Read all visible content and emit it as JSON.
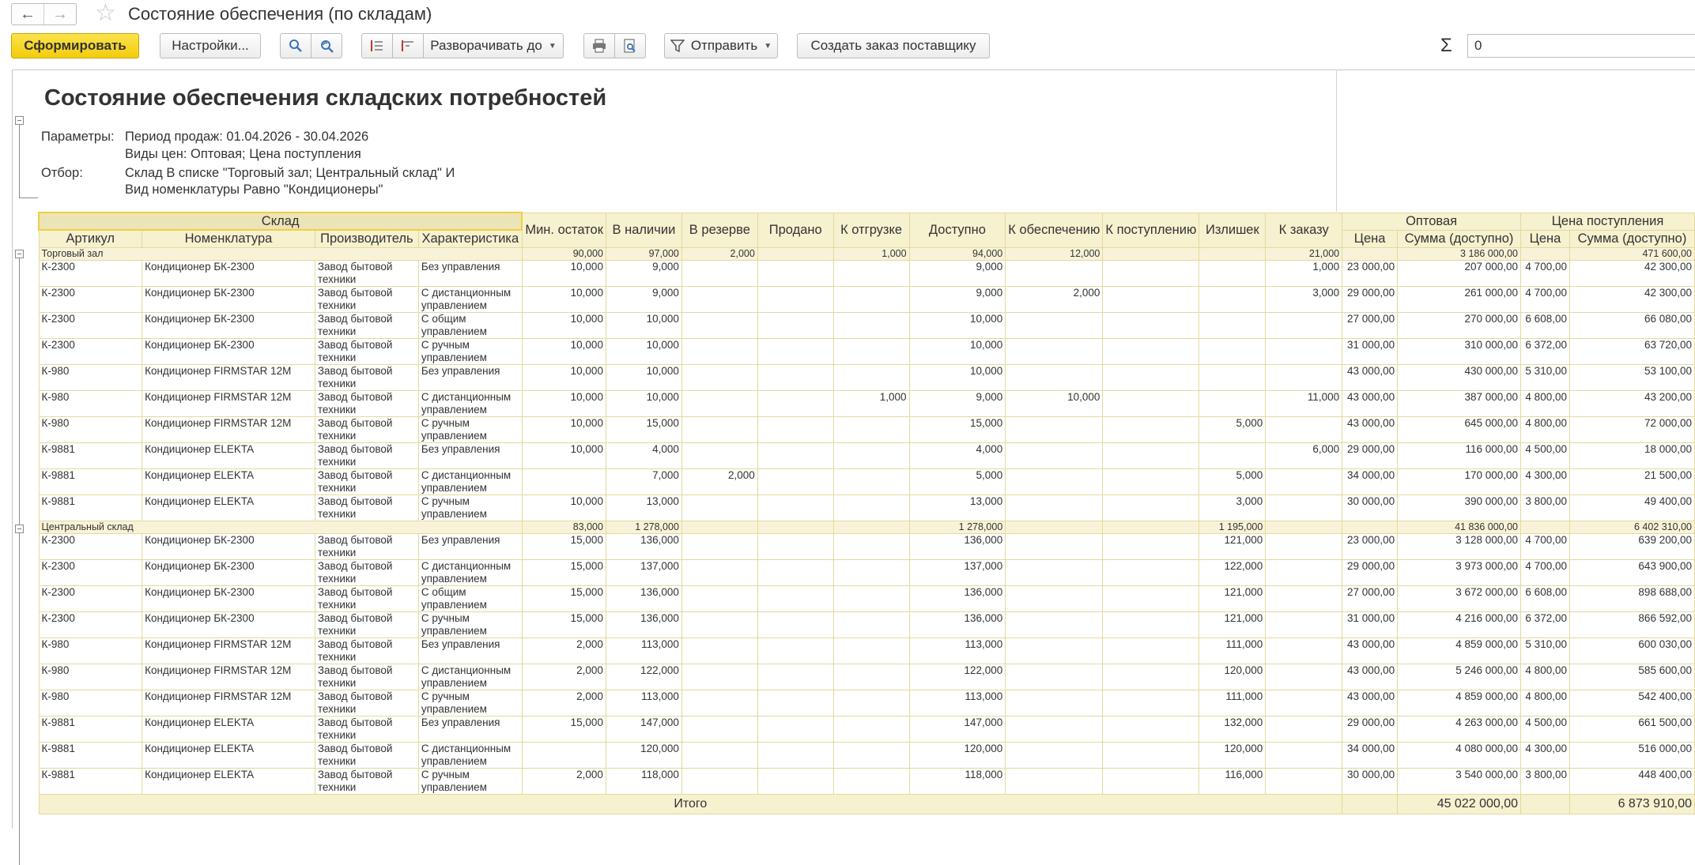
{
  "window": {
    "title": "Состояние обеспечения (по складам)",
    "nav_back": "←",
    "nav_forward": "→",
    "favorite": "☆"
  },
  "toolbar": {
    "generate_label": "Сформировать",
    "settings_label": "Настройки...",
    "expand_label": "Разворачивать до",
    "send_label": "Отправить",
    "create_order_label": "Создать заказ поставщику",
    "sigma": "Σ",
    "sum_value": "0"
  },
  "icons": {
    "search": "search-icon",
    "search_next": "search-next-icon",
    "collapse_groups": "collapse-groups-icon",
    "expand_groups": "expand-groups-icon",
    "print": "print-icon",
    "preview": "print-preview-icon",
    "send": "filter-send-icon"
  },
  "report": {
    "title": "Состояние обеспечения складских потребностей",
    "params_label": "Параметры:",
    "params_line1": "Период продаж: 01.04.2026 - 30.04.2026",
    "params_line2": "Виды цен: Оптовая; Цена поступления",
    "filter_label": "Отбор:",
    "filter_line1": "Склад В списке \"Торговый зал; Центральный склад\" И",
    "filter_line2": "Вид номенклатуры Равно \"Кондиционеры\""
  },
  "table": {
    "header_group": "Склад",
    "col_article": "Артикул",
    "col_nomenclature": "Номенклатура",
    "col_manufacturer": "Производитель",
    "col_characteristic": "Характеристика",
    "col_min_stock": "Мин. остаток",
    "col_in_stock": "В наличии",
    "col_reserved": "В резерве",
    "col_sold": "Продано",
    "col_to_ship": "К отгрузке",
    "col_available": "Доступно",
    "col_to_provide": "К обеспечению",
    "col_incoming": "К поступлению",
    "col_excess": "Излишек",
    "col_to_order": "К заказу",
    "price_group_wholesale": "Оптовая",
    "price_group_purchase": "Цена поступления",
    "col_price": "Цена",
    "col_sum_available": "Сумма (доступно)",
    "groups": [
      {
        "name": "Торговый зал",
        "totals": [
          "90,000",
          "97,000",
          "2,000",
          "",
          "1,000",
          "94,000",
          "12,000",
          "",
          "",
          "21,000",
          "",
          "3 186 000,00",
          "",
          "471 600,00"
        ],
        "rows": [
          [
            "К-2300",
            "Кондиционер БК-2300",
            "Завод бытовой техники",
            "Без управления",
            "10,000",
            "9,000",
            "",
            "",
            "",
            "9,000",
            "",
            "",
            "",
            "1,000",
            "23 000,00",
            "207 000,00",
            "4 700,00",
            "42 300,00"
          ],
          [
            "К-2300",
            "Кондиционер БК-2300",
            "Завод бытовой техники",
            "С дистанционным управлением",
            "10,000",
            "9,000",
            "",
            "",
            "",
            "9,000",
            "2,000",
            "",
            "",
            "3,000",
            "29 000,00",
            "261 000,00",
            "4 700,00",
            "42 300,00"
          ],
          [
            "К-2300",
            "Кондиционер БК-2300",
            "Завод бытовой техники",
            "С общим управлением",
            "10,000",
            "10,000",
            "",
            "",
            "",
            "10,000",
            "",
            "",
            "",
            "",
            "27 000,00",
            "270 000,00",
            "6 608,00",
            "66 080,00"
          ],
          [
            "К-2300",
            "Кондиционер БК-2300",
            "Завод бытовой техники",
            "С ручным управлением",
            "10,000",
            "10,000",
            "",
            "",
            "",
            "10,000",
            "",
            "",
            "",
            "",
            "31 000,00",
            "310 000,00",
            "6 372,00",
            "63 720,00"
          ],
          [
            "К-980",
            "Кондиционер FIRMSTAR 12M",
            "Завод бытовой техники",
            "Без управления",
            "10,000",
            "10,000",
            "",
            "",
            "",
            "10,000",
            "",
            "",
            "",
            "",
            "43 000,00",
            "430 000,00",
            "5 310,00",
            "53 100,00"
          ],
          [
            "К-980",
            "Кондиционер FIRMSTAR 12M",
            "Завод бытовой техники",
            "С дистанционным управлением",
            "10,000",
            "10,000",
            "",
            "",
            "1,000",
            "9,000",
            "10,000",
            "",
            "",
            "11,000",
            "43 000,00",
            "387 000,00",
            "4 800,00",
            "43 200,00"
          ],
          [
            "К-980",
            "Кондиционер FIRMSTAR 12M",
            "Завод бытовой техники",
            "С ручным управлением",
            "10,000",
            "15,000",
            "",
            "",
            "",
            "15,000",
            "",
            "",
            "5,000",
            "",
            "43 000,00",
            "645 000,00",
            "4 800,00",
            "72 000,00"
          ],
          [
            "К-9881",
            "Кондиционер ELEKTA",
            "Завод бытовой техники",
            "Без управления",
            "10,000",
            "4,000",
            "",
            "",
            "",
            "4,000",
            "",
            "",
            "",
            "6,000",
            "29 000,00",
            "116 000,00",
            "4 500,00",
            "18 000,00"
          ],
          [
            "К-9881",
            "Кондиционер ELEKTA",
            "Завод бытовой техники",
            "С дистанционным управлением",
            "",
            "7,000",
            "2,000",
            "",
            "",
            "5,000",
            "",
            "",
            "5,000",
            "",
            "34 000,00",
            "170 000,00",
            "4 300,00",
            "21 500,00"
          ],
          [
            "К-9881",
            "Кондиционер ELEKTA",
            "Завод бытовой техники",
            "С ручным управлением",
            "10,000",
            "13,000",
            "",
            "",
            "",
            "13,000",
            "",
            "",
            "3,000",
            "",
            "30 000,00",
            "390 000,00",
            "3 800,00",
            "49 400,00"
          ]
        ]
      },
      {
        "name": "Центральный склад",
        "totals": [
          "83,000",
          "1 278,000",
          "",
          "",
          "",
          "1 278,000",
          "",
          "",
          "1 195,000",
          "",
          "",
          "41 836 000,00",
          "",
          "6 402 310,00"
        ],
        "rows": [
          [
            "К-2300",
            "Кондиционер БК-2300",
            "Завод бытовой техники",
            "Без управления",
            "15,000",
            "136,000",
            "",
            "",
            "",
            "136,000",
            "",
            "",
            "121,000",
            "",
            "23 000,00",
            "3 128 000,00",
            "4 700,00",
            "639 200,00"
          ],
          [
            "К-2300",
            "Кондиционер БК-2300",
            "Завод бытовой техники",
            "С дистанционным управлением",
            "15,000",
            "137,000",
            "",
            "",
            "",
            "137,000",
            "",
            "",
            "122,000",
            "",
            "29 000,00",
            "3 973 000,00",
            "4 700,00",
            "643 900,00"
          ],
          [
            "К-2300",
            "Кондиционер БК-2300",
            "Завод бытовой техники",
            "С общим управлением",
            "15,000",
            "136,000",
            "",
            "",
            "",
            "136,000",
            "",
            "",
            "121,000",
            "",
            "27 000,00",
            "3 672 000,00",
            "6 608,00",
            "898 688,00"
          ],
          [
            "К-2300",
            "Кондиционер БК-2300",
            "Завод бытовой техники",
            "С ручным управлением",
            "15,000",
            "136,000",
            "",
            "",
            "",
            "136,000",
            "",
            "",
            "121,000",
            "",
            "31 000,00",
            "4 216 000,00",
            "6 372,00",
            "866 592,00"
          ],
          [
            "К-980",
            "Кондиционер FIRMSTAR 12M",
            "Завод бытовой техники",
            "Без управления",
            "2,000",
            "113,000",
            "",
            "",
            "",
            "113,000",
            "",
            "",
            "111,000",
            "",
            "43 000,00",
            "4 859 000,00",
            "5 310,00",
            "600 030,00"
          ],
          [
            "К-980",
            "Кондиционер FIRMSTAR 12M",
            "Завод бытовой техники",
            "С дистанционным управлением",
            "2,000",
            "122,000",
            "",
            "",
            "",
            "122,000",
            "",
            "",
            "120,000",
            "",
            "43 000,00",
            "5 246 000,00",
            "4 800,00",
            "585 600,00"
          ],
          [
            "К-980",
            "Кондиционер FIRMSTAR 12M",
            "Завод бытовой техники",
            "С ручным управлением",
            "2,000",
            "113,000",
            "",
            "",
            "",
            "113,000",
            "",
            "",
            "111,000",
            "",
            "43 000,00",
            "4 859 000,00",
            "4 800,00",
            "542 400,00"
          ],
          [
            "К-9881",
            "Кондиционер ELEKTA",
            "Завод бытовой техники",
            "Без управления",
            "15,000",
            "147,000",
            "",
            "",
            "",
            "147,000",
            "",
            "",
            "132,000",
            "",
            "29 000,00",
            "4 263 000,00",
            "4 500,00",
            "661 500,00"
          ],
          [
            "К-9881",
            "Кондиционер ELEKTA",
            "Завод бытовой техники",
            "С дистанционным управлением",
            "",
            "120,000",
            "",
            "",
            "",
            "120,000",
            "",
            "",
            "120,000",
            "",
            "34 000,00",
            "4 080 000,00",
            "4 300,00",
            "516 000,00"
          ],
          [
            "К-9881",
            "Кондиционер ELEKTA",
            "Завод бытовой техники",
            "С ручным управлением",
            "2,000",
            "118,000",
            "",
            "",
            "",
            "118,000",
            "",
            "",
            "116,000",
            "",
            "30 000,00",
            "3 540 000,00",
            "3 800,00",
            "448 400,00"
          ]
        ]
      }
    ],
    "total_label": "Итого",
    "total_wholesale_sum": "45 022 000,00",
    "total_purchase_sum": "6 873 910,00"
  },
  "colors": {
    "primary_button": "#f2cc0c",
    "header_bg": "#f6f1cf",
    "group_row_bg": "#f8f3d8",
    "grid_line": "#e3d99e",
    "icon_blue": "#3a74b8"
  }
}
